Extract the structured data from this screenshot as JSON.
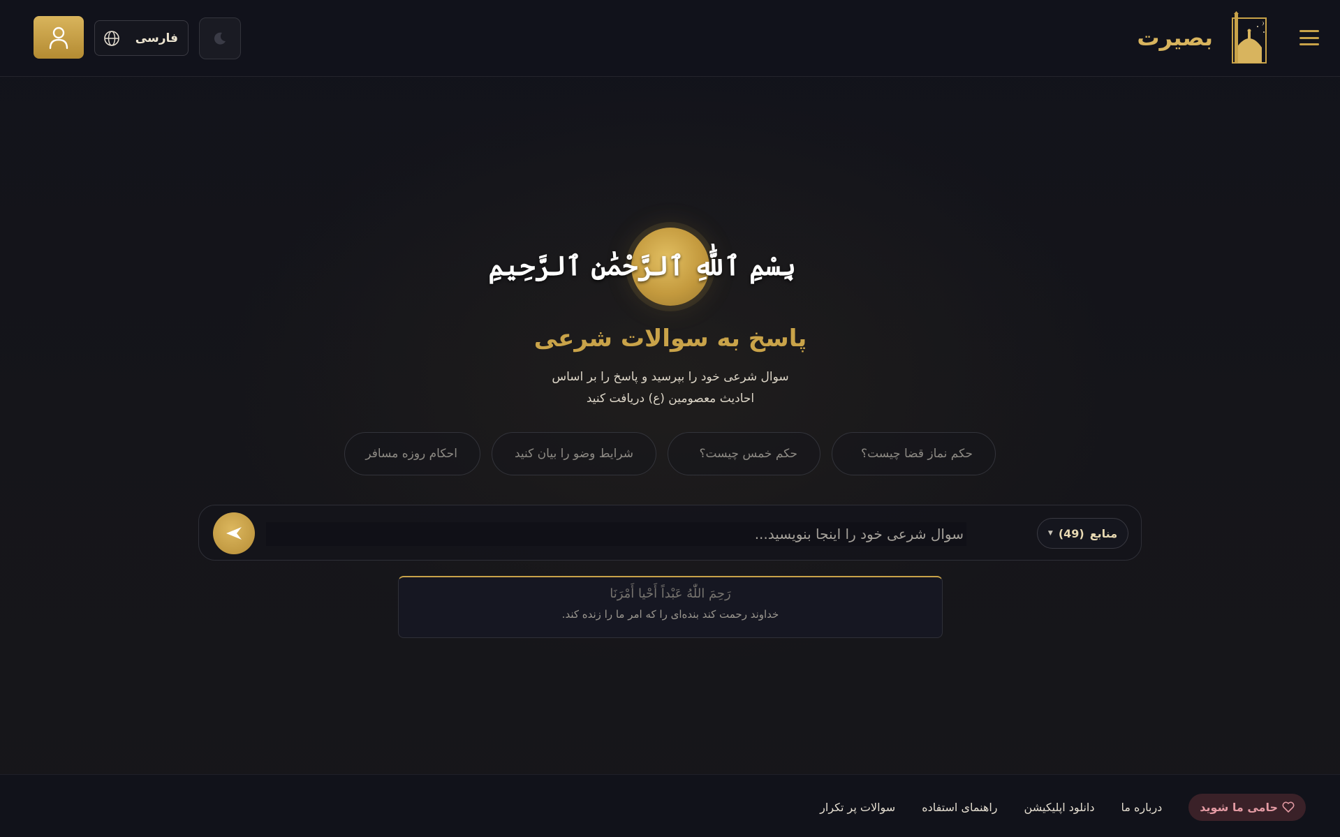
{
  "header": {
    "brand": "بصیرت",
    "language": "فارسی",
    "icons": {
      "menu": "hamburger-menu-icon",
      "logo": "mosque-logo-icon",
      "profile": "user-icon",
      "language": "globe-icon",
      "theme": "moon-icon"
    }
  },
  "hero": {
    "basmala": "بِسْمِ ٱللَّٰهِ ٱلرَّحْمَٰنِ ٱلرَّحِيمِ",
    "title": "پاسخ به سوالات شرعی",
    "subtitle_line1": "سوال شرعی خود را بپرسید و پاسخ را بر اساس",
    "subtitle_line2": "احادیث معصومین (ع) دریافت کنید"
  },
  "suggestions": [
    "حکم نماز قضا چیست؟",
    "حکم خمس چیست؟",
    "شرایط وضو را بیان کنید",
    "احکام روزه مسافر"
  ],
  "search": {
    "placeholder": "سوال شرعی خود را اینجا بنویسید...",
    "value": "",
    "sources_label": "منابع",
    "sources_count": "(49)",
    "send_icon": "send-icon"
  },
  "hadith": {
    "arabic": "رَحِمَ اللّٰهُ عَبْداً أَحْيا أَمْرَنَا",
    "translation": "خداوند رحمت کند بنده‌ای را که امر ما را زنده کند."
  },
  "footer": {
    "links": [
      "سوالات پر تکرار",
      "راهنمای استفاده",
      "دانلود اپلیکیشن",
      "درباره ما"
    ],
    "support": "حامی ما شوید",
    "support_icon": "heart-icon"
  },
  "colors": {
    "accent": "#c9a349",
    "background": "#12131b",
    "support": "#e39aa3"
  }
}
